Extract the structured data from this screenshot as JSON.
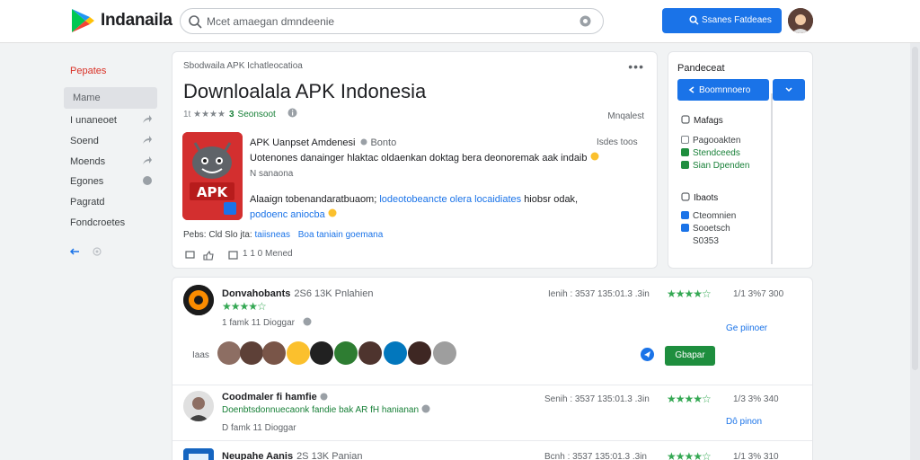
{
  "header": {
    "brand": "Indanaila",
    "search_placeholder": "Mcet amaegan dmndeenie",
    "action_button": "Ssanes Fatdeaes"
  },
  "sidebar": {
    "title": "Pepates",
    "active": "Mame",
    "items": [
      {
        "label": "I unaneoet"
      },
      {
        "label": "Soend"
      },
      {
        "label": "Moends"
      },
      {
        "label": "Egones"
      },
      {
        "label": "Pagratd"
      },
      {
        "label": "Fondcroetes"
      }
    ]
  },
  "main": {
    "breadcrumb": "Sbodwaila APK Ichatleocatioa",
    "title": "Downloalala APK Indonesia",
    "rating_text": "1t ★★★★",
    "rating_num": "3",
    "rating_ok": "Seonsoot",
    "right_note": "Mnqalest",
    "dev_line": "APK Uanpset Amdenesi",
    "dev_extra": "Bonto",
    "dev_right": "Isdes  toos",
    "desc1": "Uotenones danainger hlaktac oldaenkan doktag bera deonoremak aak indaib",
    "desc2": "N  sanaona",
    "desc3_a": "Alaaign tobenandaratbuaom;",
    "desc3_link": "lodeotobeancte olera locaidiates",
    "desc3_b": "hiobsr odak,",
    "desc4_link": "podoenc aniocba",
    "tags_prefix": "Pebs: Cld Slo jta:",
    "tag1": "taiisneas",
    "tag2": "Boa taniain goemana",
    "footer_count": "1 1 0  Mened"
  },
  "panel": {
    "header": "Pandeceat",
    "btn_main": "Boomnnoero",
    "section1": "Mafags",
    "s1_items": [
      {
        "label": "Pagooakten",
        "checked": false
      },
      {
        "label": "Stendceeds",
        "checked": true
      },
      {
        "label": "Sian Dpenden",
        "checked": true
      }
    ],
    "section2": "Ibaots",
    "s2_items": [
      {
        "label": "Cteomnien",
        "checked": true
      },
      {
        "label": "Sooetsch",
        "checked": true
      },
      {
        "label": "S0353",
        "checked": false
      }
    ]
  },
  "list": [
    {
      "name": "Donvahobants",
      "sub": "2S6 13K Pnlahien",
      "stars": "★★★★☆",
      "meta": "1  famk 11 Dioggar",
      "stat": "Ienih : 3537 135:01.3 .3in",
      "count": "1/1 3%7 300",
      "link": "Ge piinoer",
      "dev_label": "Iaas",
      "install": "Gbapar"
    },
    {
      "name": "Coodmaler fi hamfie",
      "green": "Doenbtsdonnuecaonk fandie bak AR fH hanianan",
      "stars": "★★★★☆",
      "meta": "D  famk 11 Dioggar",
      "stat": "Senih : 3537 135:01.3 .3in",
      "count": "1/3 3%  340",
      "link": "Dô pinon"
    },
    {
      "name": "Neupahe Aanis",
      "sub": "2S 13K Panian",
      "stars": "★★★★☆",
      "stat": "Bcnh : 3537 135:01.3 .3in",
      "count": "1/1 3%  310"
    }
  ],
  "colors": {
    "accent": "#1a73e8",
    "green": "#34a853",
    "red": "#d93025"
  }
}
